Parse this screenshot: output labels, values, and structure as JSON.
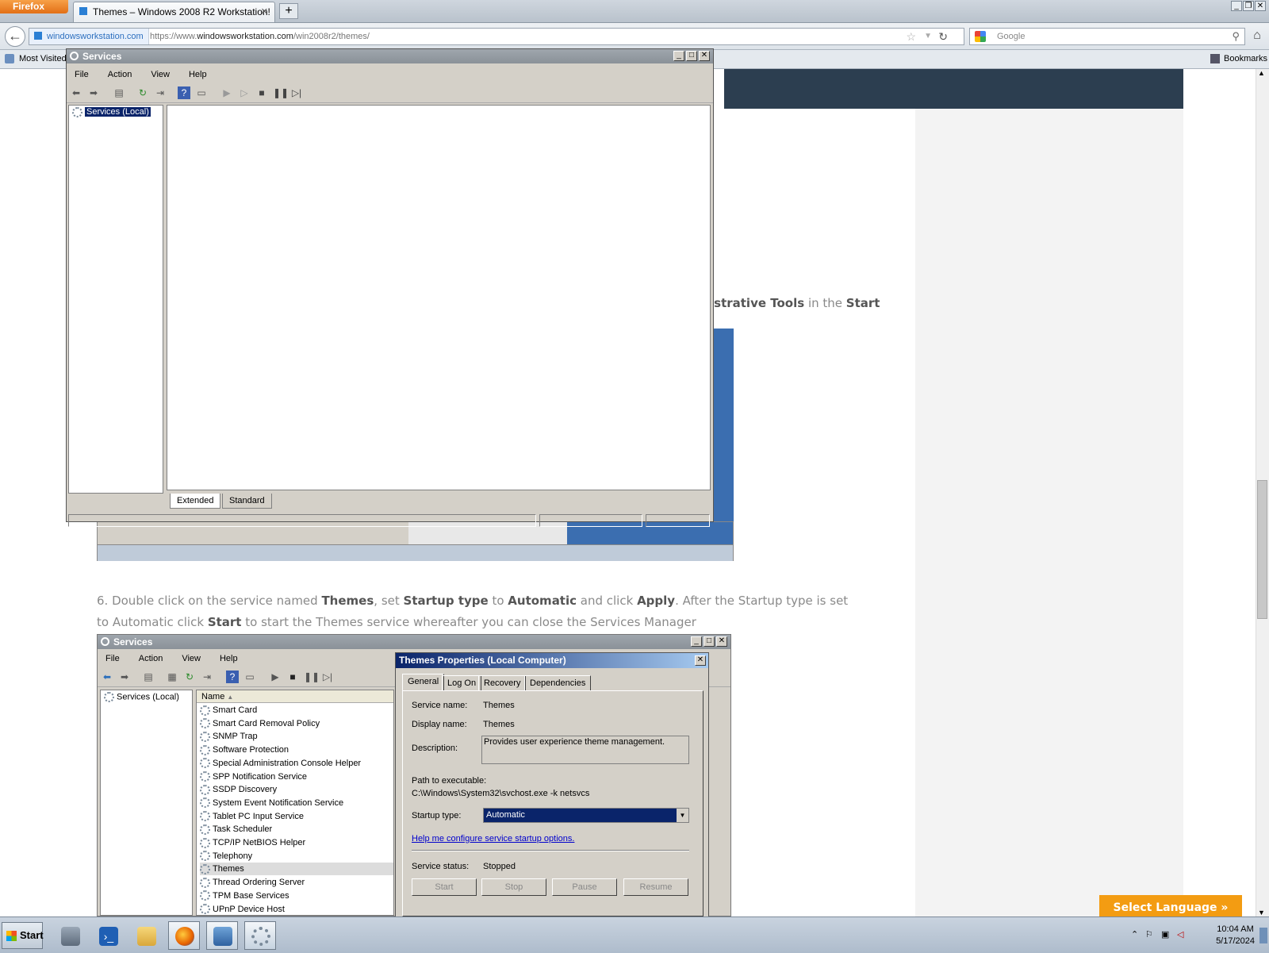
{
  "browser": {
    "menu_button": "Firefox",
    "tab_title": "Themes – Windows 2008 R2 Workstation!",
    "identity": "windowsworkstation.com",
    "url_prefix": "https://www.",
    "url_domain": "windowsworkstation.com",
    "url_path": "/win2008r2/themes/",
    "search_placeholder": "Google",
    "bookmarks_bar": {
      "most_visited": "Most Visited",
      "bookmarks": "Bookmarks"
    }
  },
  "article": {
    "para_fragment": [
      {
        "t": "istrative Tools",
        "b": true
      },
      {
        "t": " in the ",
        "b": false
      },
      {
        "t": "Start",
        "b": true
      }
    ],
    "step6": [
      {
        "t": "6. Double click on the service named ",
        "b": false
      },
      {
        "t": "Themes",
        "b": true
      },
      {
        "t": ", set ",
        "b": false
      },
      {
        "t": "Startup type",
        "b": true
      },
      {
        "t": " to ",
        "b": false
      },
      {
        "t": "Automatic",
        "b": true
      },
      {
        "t": " and click ",
        "b": false
      },
      {
        "t": "Apply",
        "b": true
      },
      {
        "t": ". After the Startup type is set to Automatic click ",
        "b": false
      },
      {
        "t": "Start",
        "b": true
      },
      {
        "t": " to start the Themes service whereafter you can close the Services Manager",
        "b": false
      }
    ],
    "select_language": "Select Language »"
  },
  "services_window": {
    "title": "Services",
    "menu": [
      "File",
      "Action",
      "View",
      "Help"
    ],
    "tree_root": "Services (Local)",
    "tabs": [
      "Extended",
      "Standard"
    ]
  },
  "screenshot2": {
    "title": "Services",
    "menu": [
      "File",
      "Action",
      "View",
      "Help"
    ],
    "tree_root": "Services (Local)",
    "column_name": "Name",
    "services": [
      "Smart Card",
      "Smart Card Removal Policy",
      "SNMP Trap",
      "Software Protection",
      "Special Administration Console Helper",
      "SPP Notification Service",
      "SSDP Discovery",
      "System Event Notification Service",
      "Tablet PC Input Service",
      "Task Scheduler",
      "TCP/IP NetBIOS Helper",
      "Telephony",
      "Themes",
      "Thread Ordering Server",
      "TPM Base Services",
      "UPnP Device Host"
    ],
    "selected_service": "Themes",
    "properties": {
      "title": "Themes Properties (Local Computer)",
      "tabs": [
        "General",
        "Log On",
        "Recovery",
        "Dependencies"
      ],
      "service_name_label": "Service name:",
      "service_name": "Themes",
      "display_name_label": "Display name:",
      "display_name": "Themes",
      "description_label": "Description:",
      "description": "Provides user experience theme management.",
      "path_label": "Path to executable:",
      "path": "C:\\Windows\\System32\\svchost.exe -k netsvcs",
      "startup_label": "Startup type:",
      "startup_value": "Automatic",
      "help_link": "Help me configure service startup options.",
      "status_label": "Service status:",
      "status_value": "Stopped",
      "buttons": [
        "Start",
        "Stop",
        "Pause",
        "Resume"
      ]
    }
  },
  "taskbar": {
    "start": "Start",
    "time": "10:04 AM",
    "date": "5/17/2024"
  }
}
